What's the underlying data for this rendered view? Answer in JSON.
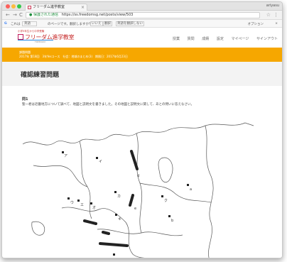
{
  "browser": {
    "tab_title": "フリーダム進学教室",
    "tab_close": "×",
    "user": "ariyasu",
    "back": "←",
    "forward": "→",
    "reload": "C",
    "lock": "🔒",
    "secure_label": "保護された通信",
    "url": "https://ss.freedomsg.net/posts/view/503",
    "star": "☆",
    "menu": "⋮"
  },
  "translate_bar": {
    "icon": "G",
    "lang_label": "これは",
    "from_lang": "英語",
    "question": "のページです。翻訳しますか？",
    "yes": "いいえ",
    "no": "翻訳",
    "never": "英語を翻訳しない",
    "options": "オプション",
    "close": "×"
  },
  "site": {
    "logo_small": "小学5年生から中学受験",
    "logo_text": "フリーダム進学教室",
    "logo_sub": "FREEDOM",
    "nav": [
      "授業",
      "質問",
      "成績",
      "設定",
      "マイページ",
      "サインアウト"
    ]
  },
  "banner": {
    "line1": "課題問題",
    "line2": "2017年 第18回　3年Yesコース　社会：地域のまとめ(3)　期限日：2017年6月23日"
  },
  "page": {
    "title": "確認練習問題",
    "question_label": "問1",
    "question_text": "聖一君は近畿地方について調べて、地図と説明文を書きました。その地図と説明文に関して、あとの問いに答えなさい。"
  },
  "map": {
    "labels": [
      "ア",
      "イ",
      "ウ",
      "エ",
      "オ",
      "カ",
      "キ",
      "ク",
      "a",
      "b",
      "c",
      "d",
      "e"
    ]
  }
}
